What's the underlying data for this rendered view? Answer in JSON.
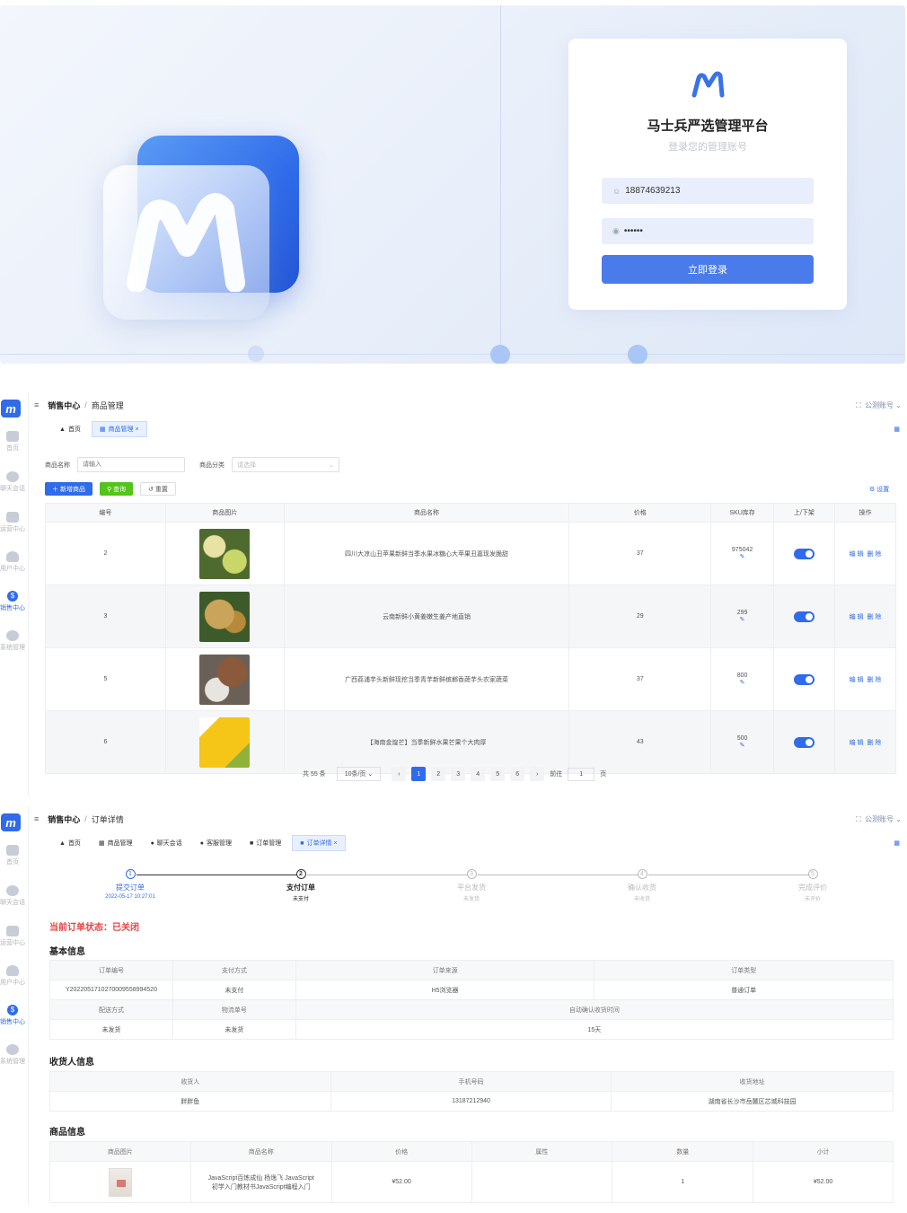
{
  "login": {
    "title": "马士兵严选管理平台",
    "subtitle": "登录您的管理账号",
    "username_value": "18874639213",
    "password_value": "••••••",
    "submit_label": "立即登录",
    "brand_letter": "m",
    "accent": "#4a7bea"
  },
  "sidebar": {
    "items": [
      {
        "label": "首页",
        "icon": "home-icon"
      },
      {
        "label": "聊天会话",
        "icon": "chat-icon"
      },
      {
        "label": "运营中心",
        "icon": "monitor-icon"
      },
      {
        "label": "用户中心",
        "icon": "user-icon"
      },
      {
        "label": "销售中心",
        "icon": "sales-icon"
      },
      {
        "label": "系统管理",
        "icon": "gear-icon"
      }
    ]
  },
  "products_page": {
    "breadcrumb_parent": "销售中心",
    "breadcrumb_current": "商品管理",
    "account": "公测账号",
    "tabs": [
      {
        "label": "首页"
      },
      {
        "label": "商品管理 ×"
      }
    ],
    "filters": {
      "name_label": "商品名称",
      "name_placeholder": "请输入",
      "category_label": "商品分类",
      "category_placeholder": "请选择"
    },
    "buttons": {
      "add": "新增商品",
      "query": "查询",
      "reset": "重置",
      "settings": "设置"
    },
    "columns": [
      "编号",
      "商品图片",
      "商品名称",
      "价格",
      "SKU库存",
      "上/下架",
      "操作"
    ],
    "rows": [
      {
        "id": "2",
        "name": "四川大凉山丑苹果新鲜当季水果冰糖心大苹果丑嘉现发脆甜",
        "price": "37",
        "stock": "975042"
      },
      {
        "id": "3",
        "name": "云南新鲜小黄姜嫩生姜产地直销",
        "price": "29",
        "stock": "299"
      },
      {
        "id": "5",
        "name": "广西荔浦芋头新鲜现挖当季青芋新鲜槟榔香蔬芋头农家蔬菜",
        "price": "37",
        "stock": "800"
      },
      {
        "id": "6",
        "name": "【海南金煌芒】当季新鲜水果芒果个大肉厚",
        "price": "43",
        "stock": "500"
      }
    ],
    "row_actions": {
      "edit": "编 辑",
      "delete": "删 除"
    },
    "pagination": {
      "total": "共 55 条",
      "page_size": "10条/页",
      "pages": [
        "1",
        "2",
        "3",
        "4",
        "5",
        "6"
      ],
      "current": "1",
      "goto_label": "前往",
      "goto_value": "1",
      "page_unit": "页"
    }
  },
  "order_page": {
    "breadcrumb_parent": "销售中心",
    "breadcrumb_current": "订单详情",
    "account": "公测账号",
    "tabs": [
      {
        "label": "首页"
      },
      {
        "label": "商品管理"
      },
      {
        "label": "聊天会话"
      },
      {
        "label": "客服管理"
      },
      {
        "label": "订单管理"
      },
      {
        "label": "订单详情 ×"
      }
    ],
    "steps": [
      {
        "num": "1",
        "title": "提交订单",
        "sub": "2022-05-17 10:27:01"
      },
      {
        "num": "2",
        "title": "支付订单",
        "sub": "未支付"
      },
      {
        "num": "3",
        "title": "平台发货",
        "sub": "未发货"
      },
      {
        "num": "4",
        "title": "确认收货",
        "sub": "未收货"
      },
      {
        "num": "5",
        "title": "完成评价",
        "sub": "未评价"
      }
    ],
    "status_text": "当前订单状态：已关闭",
    "basic_title": "基本信息",
    "basic": {
      "h1": [
        "订单编号",
        "支付方式",
        "订单来源",
        "订单类型"
      ],
      "v1": [
        "Y2022051710270009558994520",
        "未支付",
        "H5浏览器",
        "普通订单"
      ],
      "h2": [
        "配送方式",
        "物流单号",
        "自动确认收货时间"
      ],
      "v2": [
        "未发货",
        "未发货",
        "15天"
      ]
    },
    "receiver_title": "收货人信息",
    "receiver": {
      "headers": [
        "收货人",
        "手机号码",
        "收货地址"
      ],
      "values": [
        "胖胖鱼",
        "13187212940",
        "湖南省长沙市岳麓区芯城科技园"
      ]
    },
    "goods_title": "商品信息",
    "goods": {
      "headers": [
        "商品图片",
        "商品名称",
        "价格",
        "属性",
        "数量",
        "小计"
      ],
      "name_line1": "JavaScript百炼成仙 杨逸飞 JavaScript",
      "name_line2": "初学入门教材书JavaScript编程入门",
      "price": "¥52.00",
      "attr": "",
      "qty": "1",
      "subtotal": "¥52.00"
    }
  }
}
